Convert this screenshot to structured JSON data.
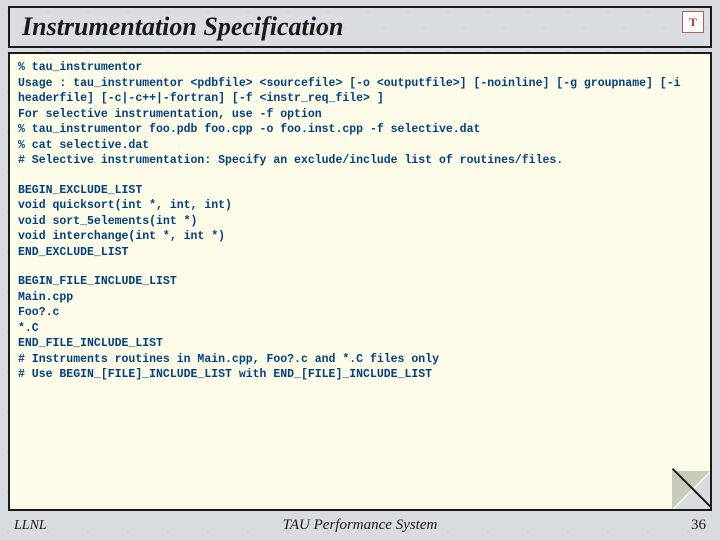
{
  "header": {
    "title": "Instrumentation Specification",
    "logo_label": "T"
  },
  "code": {
    "block1": "% tau_instrumentor\nUsage : tau_instrumentor <pdbfile> <sourcefile> [-o <outputfile>] [-noinline] [-g groupname] [-i headerfile] [-c|-c++|-fortran] [-f <instr_req_file> ]\nFor selective instrumentation, use -f option\n% tau_instrumentor foo.pdb foo.cpp -o foo.inst.cpp -f selective.dat\n% cat selective.dat\n# Selective instrumentation: Specify an exclude/include list of routines/files.",
    "block2": "BEGIN_EXCLUDE_LIST\nvoid quicksort(int *, int, int)\nvoid sort_5elements(int *)\nvoid interchange(int *, int *)\nEND_EXCLUDE_LIST",
    "block3": "BEGIN_FILE_INCLUDE_LIST\nMain.cpp\nFoo?.c\n*.C\nEND_FILE_INCLUDE_LIST\n# Instruments routines in Main.cpp, Foo?.c and *.C files only\n# Use BEGIN_[FILE]_INCLUDE_LIST with END_[FILE]_INCLUDE_LIST"
  },
  "footer": {
    "left": "LLNL",
    "center": "TAU Performance System",
    "page": "36"
  }
}
